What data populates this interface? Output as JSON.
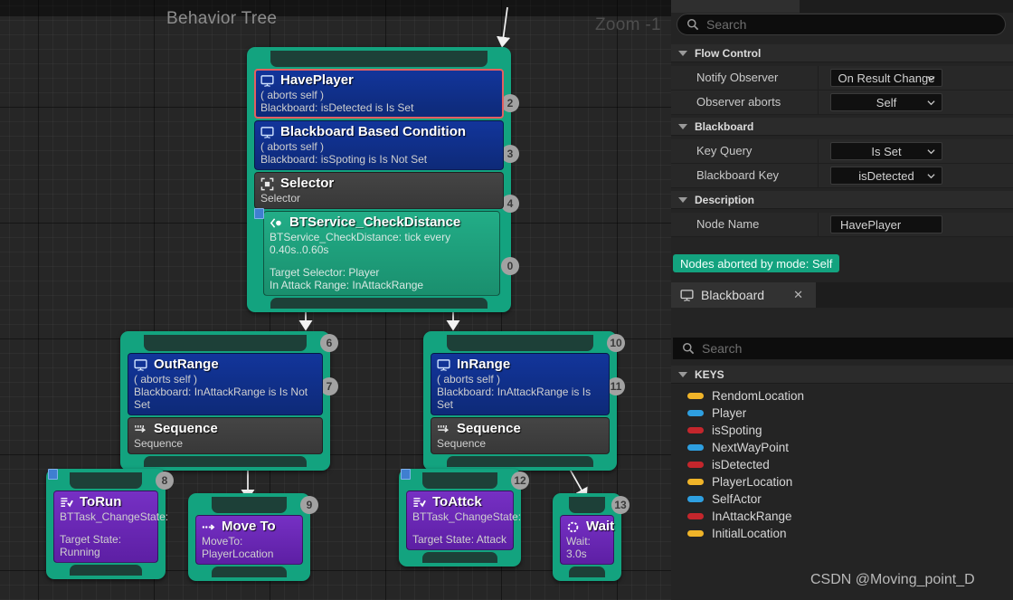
{
  "graph": {
    "title": "Behavior Tree",
    "zoom_label": "Zoom -1",
    "nodes": [
      {
        "id": "root-selector",
        "index": [
          "2",
          "3",
          "4",
          "0"
        ],
        "blocks": [
          {
            "kind": "decorator",
            "selected": true,
            "icon": "blackboard-icon",
            "title": "HavePlayer",
            "lines": [
              "( aborts self )",
              "Blackboard: isDetected is Is Set"
            ]
          },
          {
            "kind": "decorator",
            "selected": false,
            "icon": "blackboard-icon",
            "title": "Blackboard Based Condition",
            "lines": [
              "( aborts self )",
              "Blackboard: isSpoting is Is Not Set"
            ]
          },
          {
            "kind": "composite",
            "icon": "selector-icon",
            "title": "Selector",
            "lines": [
              "Selector"
            ]
          },
          {
            "kind": "service",
            "icon": "service-icon",
            "breakpoint": true,
            "title": "BTService_CheckDistance",
            "lines": [
              "BTService_CheckDistance: tick every 0.40s..0.60s",
              "",
              "Target Selector: Player",
              "In Attack Range: InAttackRange"
            ]
          }
        ]
      },
      {
        "id": "outrange",
        "index": [
          "6",
          "7"
        ],
        "blocks": [
          {
            "kind": "decorator",
            "selected": false,
            "icon": "blackboard-icon",
            "title": "OutRange",
            "lines": [
              "( aborts self )",
              "Blackboard: InAttackRange is Is Not Set"
            ]
          },
          {
            "kind": "composite",
            "icon": "sequence-icon",
            "title": "Sequence",
            "lines": [
              "Sequence"
            ]
          }
        ]
      },
      {
        "id": "inrange",
        "index": [
          "10",
          "11"
        ],
        "blocks": [
          {
            "kind": "decorator",
            "selected": false,
            "icon": "blackboard-icon",
            "title": "InRange",
            "lines": [
              "( aborts self )",
              "Blackboard: InAttackRange is Is Set"
            ]
          },
          {
            "kind": "composite",
            "icon": "sequence-icon",
            "title": "Sequence",
            "lines": [
              "Sequence"
            ]
          }
        ]
      },
      {
        "id": "torun",
        "index": [
          "8"
        ],
        "blocks": [
          {
            "kind": "task",
            "icon": "changestate-icon",
            "breakpoint": true,
            "title": "ToRun",
            "lines": [
              "BTTask_ChangeState:",
              "",
              "Target State: Running"
            ]
          }
        ]
      },
      {
        "id": "moveto",
        "index": [
          "9"
        ],
        "blocks": [
          {
            "kind": "task",
            "icon": "moveto-icon",
            "title": "Move To",
            "lines": [
              "MoveTo: PlayerLocation"
            ]
          }
        ]
      },
      {
        "id": "toattck",
        "index": [
          "12"
        ],
        "blocks": [
          {
            "kind": "task",
            "icon": "changestate-icon",
            "breakpoint": true,
            "title": "ToAttck",
            "lines": [
              "BTTask_ChangeState:",
              "",
              "Target State: Attack"
            ]
          }
        ]
      },
      {
        "id": "wait",
        "index": [
          "13"
        ],
        "blocks": [
          {
            "kind": "task",
            "icon": "wait-icon",
            "title": "Wait",
            "lines": [
              "Wait: 3.0s"
            ]
          }
        ]
      }
    ]
  },
  "details": {
    "search_placeholder": "Search",
    "categories": [
      {
        "name": "Flow Control"
      },
      {
        "name": "Blackboard"
      },
      {
        "name": "Description"
      }
    ],
    "rows": [
      {
        "label": "Notify Observer",
        "value": "On Result Change",
        "control": "combo"
      },
      {
        "label": "Observer aborts",
        "value": "Self",
        "control": "combo"
      },
      {
        "label": "Key Query",
        "value": "Is Set",
        "control": "combo"
      },
      {
        "label": "Blackboard Key",
        "value": "isDetected",
        "control": "combo"
      },
      {
        "label": "Node Name",
        "value": "HavePlayer",
        "control": "text"
      }
    ],
    "aborted_pill": "Nodes aborted by mode: Self"
  },
  "blackboard": {
    "tab_label": "Blackboard",
    "tab_close": "✕",
    "search_placeholder": "Search",
    "section": "KEYS",
    "keys": [
      {
        "name": "RendomLocation",
        "color": "#f0b429"
      },
      {
        "name": "Player",
        "color": "#2e9fe0"
      },
      {
        "name": "isSpoting",
        "color": "#c4262c"
      },
      {
        "name": "NextWayPoint",
        "color": "#2e9fe0"
      },
      {
        "name": "isDetected",
        "color": "#c4262c"
      },
      {
        "name": "PlayerLocation",
        "color": "#f0b429"
      },
      {
        "name": "SelfActor",
        "color": "#2e9fe0"
      },
      {
        "name": "InAttackRange",
        "color": "#c4262c"
      },
      {
        "name": "InitialLocation",
        "color": "#f0b429"
      }
    ]
  },
  "watermark": "CSDN @Moving_point_D",
  "colors": {
    "node_green": "#13a37f",
    "decorator_blue": "#10308f",
    "task_purple": "#6d28b8",
    "selected_red": "#e46060"
  }
}
